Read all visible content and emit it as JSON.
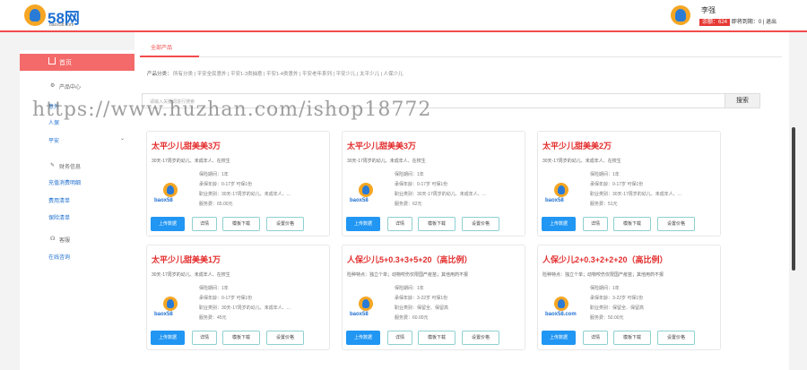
{
  "header": {
    "logo_text": "58网",
    "logo_sub": "baox58.com",
    "user_name": "李强",
    "user_badge": "余额：624",
    "user_pending": "即将到期：0",
    "logout": "退出"
  },
  "sidebar": {
    "home": "首页",
    "product_center": "产品中心",
    "items": [
      "意外",
      "人保",
      "平安"
    ],
    "finance": "财务信息",
    "finance_links": [
      "充值消费明细",
      "费用清单",
      "保险清单"
    ],
    "service": "客服",
    "service_links": [
      "在线咨询"
    ]
  },
  "main": {
    "tab": "全部产品",
    "categories_label": "产品分类：",
    "categories": [
      "所有分类",
      "平安全民意外",
      "平安1-3类抽意",
      "平安1-4类意外",
      "平安老年系列",
      "平安少儿",
      "太平少儿",
      "人保少儿"
    ],
    "search_placeholder": "请输入关键词进行搜索",
    "search_button": "搜索"
  },
  "cards": [
    {
      "title": "太平少儿甜美美3万",
      "desc": "30天-17周岁的幼儿、未成年人、在校生",
      "lines": [
        "保险期间：1年",
        "承保年龄：0-17岁 可保1份",
        "职业类别：30天-17周岁的幼儿、未成年人、...",
        "服务费：65.00元"
      ],
      "logo": "baox58"
    },
    {
      "title": "太平少儿甜美美3万",
      "desc": "30天-17周岁的幼儿、未成年人、在校生",
      "lines": [
        "保险期间：1年",
        "承保年龄：0-17岁 可保1份",
        "职业类别：30天-17周岁的幼儿、未成年人、...",
        "服务费：62元"
      ],
      "logo": "baox58"
    },
    {
      "title": "太平少儿甜美美2万",
      "desc": "30天-17周岁的幼儿、未成年人、在校生",
      "lines": [
        "保险期间：1年",
        "承保年龄：0-17岁 可保1份",
        "职业类别：30天-17周岁的幼儿、未成年人、...",
        "服务费：51元"
      ],
      "logo": "baox58"
    },
    {
      "title": "太平少儿甜美美1万",
      "desc": "30天-17周岁的幼儿、未成年人、在校生",
      "lines": [
        "保险期间：1年",
        "承保年龄：0-17岁 可保1份",
        "职业类别：30天-17周岁的幼儿、未成年人、...",
        "服务费：45元"
      ],
      "logo": "baox58"
    },
    {
      "title": "人保少儿5+0.3+3+5+20（高比例）",
      "desc": "险种特点：独立个单；动物咬伤仅限国产疫苗；其他用药不报",
      "lines": [
        "保险期间：1年",
        "承保年龄：3-22岁 可保1份",
        "职业类别：保留全、保留高",
        "服务费：60.00元"
      ],
      "logo": "baox58"
    },
    {
      "title": "人保少儿2+0.3+2+2+20（高比例）",
      "desc": "险种特点：独立个单；动物咬伤仅限国产疫苗；其他用药不报",
      "lines": [
        "保险期间：1年",
        "承保年龄：3-22岁 可保1份",
        "职业类别：保留全、保留高",
        "服务费：50.00元"
      ],
      "logo": "baox58.com"
    }
  ],
  "buttons": {
    "upload": "上传数据",
    "detail": "详情",
    "template": "模板下载",
    "price": "设置价格"
  },
  "watermark": "https://www.huzhan.com/ishop18772"
}
